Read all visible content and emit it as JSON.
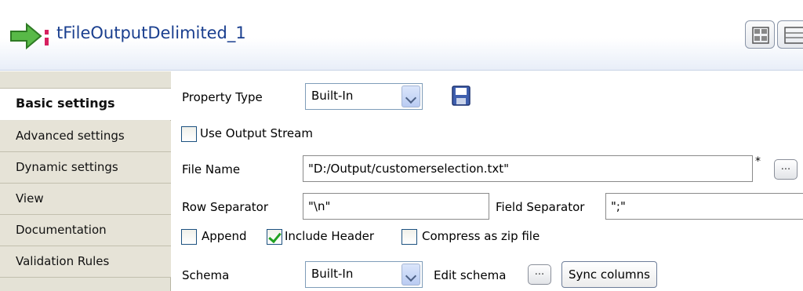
{
  "header": {
    "title": "tFileOutputDelimited_1"
  },
  "sidebar": {
    "items": [
      {
        "label": "Basic settings"
      },
      {
        "label": "Advanced settings"
      },
      {
        "label": "Dynamic settings"
      },
      {
        "label": "View"
      },
      {
        "label": "Documentation"
      },
      {
        "label": "Validation Rules"
      }
    ]
  },
  "form": {
    "property_type_label": "Property Type",
    "property_type_value": "Built-In",
    "use_output_stream_label": "Use Output Stream",
    "file_name_label": "File Name",
    "file_name_value": "\"D:/Output/customerselection.txt\"",
    "file_name_marker": "*",
    "row_separator_label": "Row Separator",
    "row_separator_value": "\"\\n\"",
    "field_separator_label": "Field Separator",
    "field_separator_value": "\";\"",
    "append_label": "Append",
    "include_header_label": "Include Header",
    "compress_label": "Compress as zip file",
    "schema_label": "Schema",
    "schema_value": "Built-In",
    "edit_schema_label": "Edit schema",
    "dots_label": "...",
    "sync_columns_label": "Sync columns"
  },
  "checkbox_states": {
    "use_output_stream": false,
    "append": false,
    "include_header": true,
    "compress": false
  },
  "colors": {
    "title": "#1a3f8f",
    "sidebar_bg": "#e4e2d6",
    "check_mark": "#21a121"
  }
}
